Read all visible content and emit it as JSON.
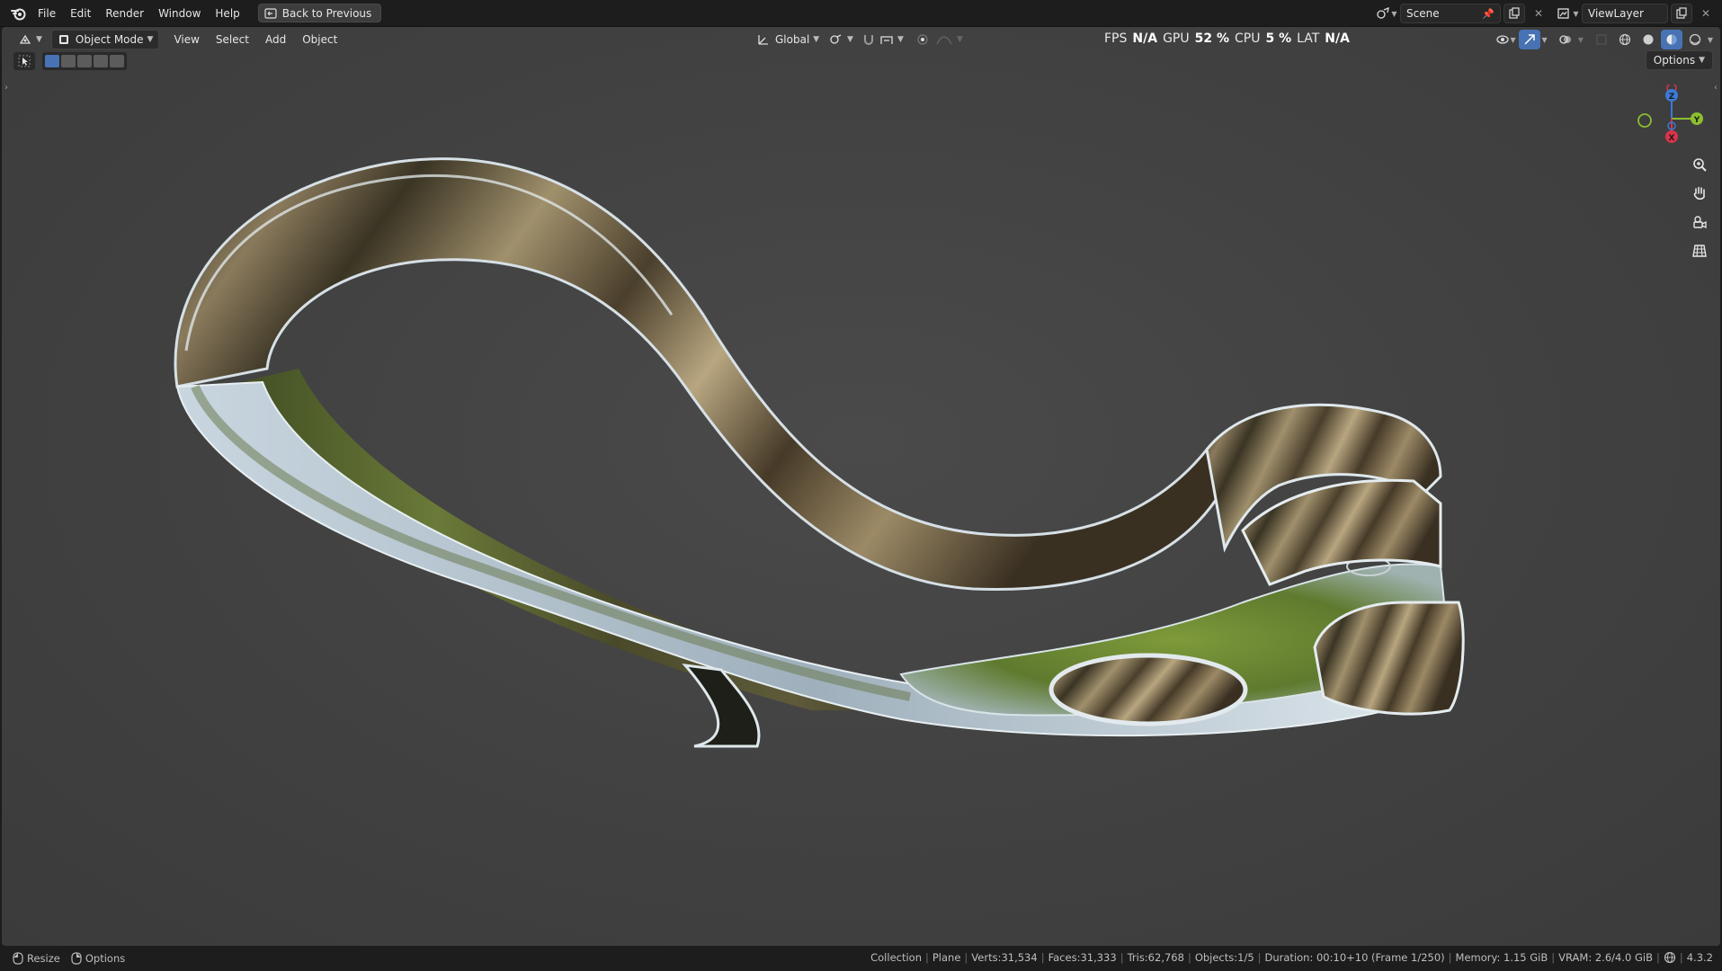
{
  "menubar": {
    "items": [
      "File",
      "Edit",
      "Render",
      "Window",
      "Help"
    ],
    "back_label": "Back to Previous",
    "scene_name": "Scene",
    "view_layer": "ViewLayer"
  },
  "viewport_header": {
    "mode": "Object Mode",
    "menus": [
      "View",
      "Select",
      "Add",
      "Object"
    ],
    "orientation": "Global",
    "options_label": "Options"
  },
  "performance": {
    "fps_label": "FPS",
    "fps_value": "N/A",
    "gpu_label": "GPU",
    "gpu_value": "52 %",
    "cpu_label": "CPU",
    "cpu_value": "5 %",
    "lat_label": "LAT",
    "lat_value": "N/A"
  },
  "gizmo": {
    "x_label": "X",
    "y_label": "Y",
    "z_label": "Z",
    "colors": {
      "x": "#d8344a",
      "y": "#8cbe2e",
      "z": "#3b7ad6"
    }
  },
  "statusbar": {
    "resize_label": "Resize",
    "options_label": "Options",
    "collection": "Collection",
    "object": "Plane",
    "verts": "Verts:31,534",
    "faces": "Faces:31,333",
    "tris": "Tris:62,768",
    "objects": "Objects:1/5",
    "duration": "Duration: 00:10+10 (Frame 1/250)",
    "memory": "Memory: 1.15 GiB",
    "vram": "VRAM: 2.6/4.0 GiB",
    "version": "4.3.2"
  },
  "icons": {
    "blender": "blender-logo-icon",
    "back": "back-screen-icon",
    "zoom": "zoom-icon",
    "pan": "hand-icon",
    "camera": "camera-icon",
    "grid": "grid-icon"
  }
}
